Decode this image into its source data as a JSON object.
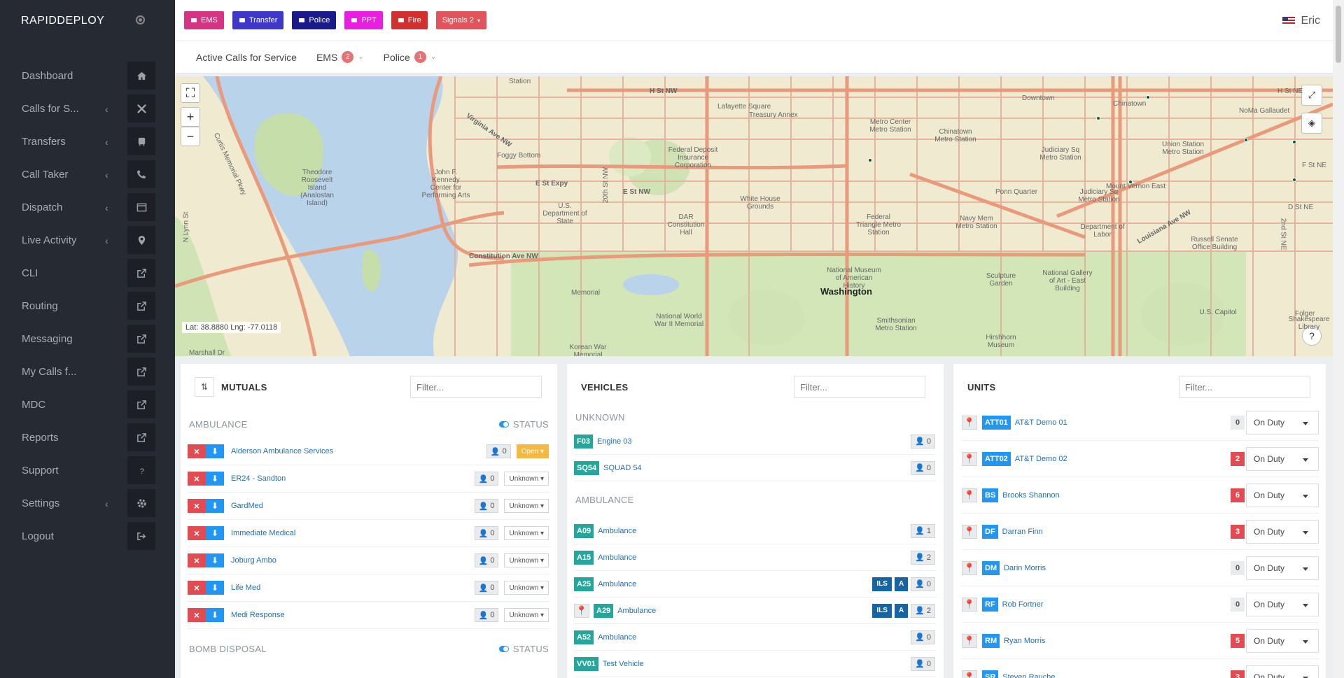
{
  "brand": "RAPIDDEPLOY",
  "nav": [
    {
      "label": "Dashboard",
      "icon": "home-icon",
      "chev": false
    },
    {
      "label": "Calls for S...",
      "icon": "tools-icon",
      "chev": true
    },
    {
      "label": "Transfers",
      "icon": "bus-icon",
      "chev": true
    },
    {
      "label": "Call Taker",
      "icon": "phone-icon",
      "chev": true
    },
    {
      "label": "Dispatch",
      "icon": "window-icon",
      "chev": true
    },
    {
      "label": "Live Activity",
      "icon": "map-pin-icon",
      "chev": true
    },
    {
      "label": "CLI",
      "icon": "external-link-icon",
      "chev": false
    },
    {
      "label": "Routing",
      "icon": "external-link-icon",
      "chev": false
    },
    {
      "label": "Messaging",
      "icon": "external-link-icon",
      "chev": false
    },
    {
      "label": "My Calls f...",
      "icon": "external-link-icon",
      "chev": false
    },
    {
      "label": "MDC",
      "icon": "external-link-icon",
      "chev": false
    },
    {
      "label": "Reports",
      "icon": "external-link-icon",
      "chev": false
    },
    {
      "label": "Support",
      "icon": "question-icon",
      "chev": false
    },
    {
      "label": "Settings",
      "icon": "gear-icon",
      "chev": true
    },
    {
      "label": "Logout",
      "icon": "logout-icon",
      "chev": false
    }
  ],
  "topbar": {
    "buttons": [
      {
        "label": "EMS",
        "color": "#d63384",
        "icon": "megaphone-icon"
      },
      {
        "label": "Transfer",
        "color": "#3f37c9",
        "icon": "bus-icon"
      },
      {
        "label": "Police",
        "color": "#1a1a8c",
        "icon": "shield-icon"
      },
      {
        "label": "PPT",
        "color": "#e91ee0",
        "icon": "car-icon"
      },
      {
        "label": "Fire",
        "color": "#d32f2f",
        "icon": "extinguisher-icon"
      }
    ],
    "signals": "Signals 2",
    "user": "Eric"
  },
  "subtabs": {
    "active": "Active Calls for Service",
    "ems": "EMS",
    "ems_count": "2",
    "police": "Police",
    "police_count": "1"
  },
  "map": {
    "coords": "Lat: 38.8880 Lng: -77.0118",
    "city": "Washington",
    "zoom_in": "+",
    "zoom_out": "−",
    "help": "?",
    "labels": [
      "Theodore Roosevelt Island (Analostan Island)",
      "Foggy Bottom",
      "John F. Kennedy Center for Performing Arts",
      "U.S. Department of State",
      "Federal Deposit Insurance Corporation",
      "Lafayette Square",
      "Treasury Annex",
      "White House Grounds",
      "DAR Constitution Hall",
      "Metro Center Metro Station",
      "Chinatown Metro Station",
      "Federal Triangle Metro Station",
      "National Museum of American History",
      "Smithsonian Metro Station",
      "National World War II Memorial",
      "Korean War Memorial",
      "Judiciary Sq Metro Station",
      "Navy Mem Metro Station",
      "Ponn Quarter",
      "Sculpture Garden",
      "National Gallery of Art - East Building",
      "Hirshhorn Museum",
      "Department of Labor",
      "Union Station Metro Station",
      "NoMa Gallaudet",
      "Russell Senate Office Building",
      "U.S. Capitol",
      "Judiciary Sq Metro Station",
      "Chinatown",
      "Downtown",
      "Mount Vernon East",
      "H St NW",
      "E St NW",
      "E St Expy",
      "Constitution Ave NW",
      "Virginia Ave NW",
      "Louisiana Ave NW",
      "Marshall Dr",
      "Curtis Memorial Pkwy",
      "N Lynn St",
      "2nd St NE",
      "D St NE",
      "F St NE",
      "H St NE",
      "Station",
      "20th St NW",
      "Memorial",
      "Shakespeare Library",
      "Folger"
    ]
  },
  "mutuals": {
    "title": "MUTUALS",
    "filter": "Filter...",
    "status_label": "STATUS",
    "sections": [
      {
        "name": "AMBULANCE",
        "rows": [
          {
            "name": "Alderson Ambulance Services",
            "count": "0",
            "status": "Open"
          },
          {
            "name": "ER24 - Sandton",
            "count": "0",
            "status": "Unknown"
          },
          {
            "name": "GardMed",
            "count": "0",
            "status": "Unknown"
          },
          {
            "name": "Immediate Medical",
            "count": "0",
            "status": "Unknown"
          },
          {
            "name": "Joburg Ambo",
            "count": "0",
            "status": "Unknown"
          },
          {
            "name": "Life Med",
            "count": "0",
            "status": "Unknown"
          },
          {
            "name": "Medi Response",
            "count": "0",
            "status": "Unknown"
          }
        ]
      },
      {
        "name": "BOMB DISPOSAL",
        "rows": []
      }
    ]
  },
  "vehicles": {
    "title": "VEHICLES",
    "filter": "Filter...",
    "unknown_title": "UNKNOWN",
    "unknown": [
      {
        "tag": "F03",
        "name": "Engine 03",
        "count": "0"
      },
      {
        "tag": "SQ54",
        "name": "SQUAD 54",
        "count": "0"
      }
    ],
    "ambulance_title": "AMBULANCE",
    "ambulance": [
      {
        "tag": "A09",
        "name": "Ambulance",
        "count": "1",
        "ils": "",
        "a": "",
        "pin": false
      },
      {
        "tag": "A15",
        "name": "Ambulance",
        "count": "2",
        "ils": "",
        "a": "",
        "pin": false
      },
      {
        "tag": "A25",
        "name": "Ambulance",
        "count": "0",
        "ils": "ILS",
        "a": "A",
        "pin": false
      },
      {
        "tag": "A29",
        "name": "Ambulance",
        "count": "2",
        "ils": "ILS",
        "a": "A",
        "pin": true
      },
      {
        "tag": "A52",
        "name": "Ambulance",
        "count": "0",
        "ils": "",
        "a": "",
        "pin": false
      },
      {
        "tag": "VV01",
        "name": "Test Vehicle",
        "count": "0",
        "ils": "",
        "a": "",
        "pin": false
      }
    ]
  },
  "units": {
    "title": "UNITS",
    "filter": "Filter...",
    "rows": [
      {
        "tag": "ATT01",
        "name": "AT&T Demo 01",
        "count": "0",
        "status": "On Duty"
      },
      {
        "tag": "ATT02",
        "name": "AT&T Demo 02",
        "count": "2",
        "status": "On Duty"
      },
      {
        "tag": "BS",
        "name": "Brooks Shannon",
        "count": "6",
        "status": "On Duty"
      },
      {
        "tag": "DF",
        "name": "Darran Finn",
        "count": "3",
        "status": "On Duty"
      },
      {
        "tag": "DM",
        "name": "Darin Morris",
        "count": "0",
        "status": "On Duty"
      },
      {
        "tag": "RF",
        "name": "Rob Fortner",
        "count": "0",
        "status": "On Duty"
      },
      {
        "tag": "RM",
        "name": "Ryan Morris",
        "count": "5",
        "status": "On Duty"
      },
      {
        "tag": "SR",
        "name": "Steven Rauche",
        "count": "3",
        "status": "On Duty"
      }
    ]
  }
}
